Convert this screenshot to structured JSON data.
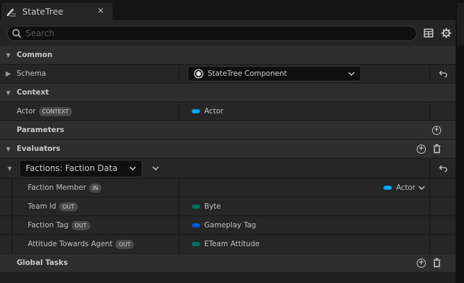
{
  "tab": {
    "title": "StateTree",
    "icon": "pencil-icon",
    "close": "×"
  },
  "search": {
    "placeholder": "Search",
    "value": ""
  },
  "sections": {
    "common": "Common",
    "schema": {
      "label": "Schema",
      "value": "StateTree Component"
    },
    "context": "Context",
    "actor": {
      "label": "Actor",
      "badge": "CONTEXT",
      "value": "Actor",
      "color": "#00a8f0"
    },
    "parameters": "Parameters",
    "evaluators": "Evaluators",
    "evaluator": {
      "name": "Factions: Faction Data",
      "props": [
        {
          "label": "Faction Member",
          "badge": "IN",
          "value": "Actor",
          "color": "#00a8f0"
        },
        {
          "label": "Team Id",
          "badge": "OUT",
          "value": "Byte",
          "color": "#006d62"
        },
        {
          "label": "Faction Tag",
          "badge": "OUT",
          "value": "Gameplay Tag",
          "color": "#0058d0"
        },
        {
          "label": "Attitude Towards Agent",
          "badge": "OUT",
          "value": "ETeam Attitude",
          "color": "#006d62"
        }
      ]
    },
    "global_tasks": "Global Tasks"
  }
}
